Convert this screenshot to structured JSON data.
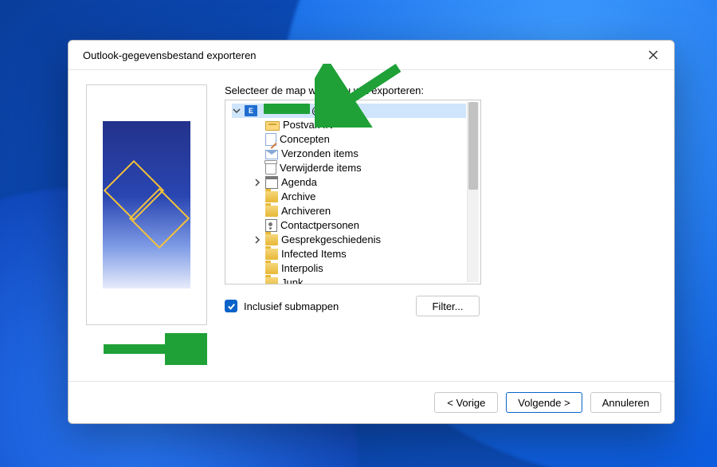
{
  "dialog": {
    "title": "Outlook-gegevensbestand exporteren",
    "field_label": "Selecteer de map waaruit u wilt exporteren:",
    "account_icon_letter": "E",
    "account_suffix": "@live.nl",
    "folders": [
      {
        "label": "Postvak IN",
        "icon": "inbox"
      },
      {
        "label": "Concepten",
        "icon": "draft"
      },
      {
        "label": "Verzonden items",
        "icon": "sent"
      },
      {
        "label": "Verwijderde items",
        "icon": "trash"
      },
      {
        "label": "Agenda",
        "icon": "cal",
        "expandable": true
      },
      {
        "label": "Archive",
        "icon": "folder"
      },
      {
        "label": "Archiveren",
        "icon": "folder"
      },
      {
        "label": "Contactpersonen",
        "icon": "contacts"
      },
      {
        "label": "Gesprekgeschiedenis",
        "icon": "folder",
        "expandable": true
      },
      {
        "label": "Infected Items",
        "icon": "folder"
      },
      {
        "label": "Interpolis",
        "icon": "folder"
      },
      {
        "label": "Junk",
        "icon": "folder"
      }
    ],
    "checkbox_label": "Inclusief submappen",
    "filter_button": "Filter...",
    "back_button": "< Vorige",
    "next_button": "Volgende >",
    "cancel_button": "Annuleren"
  }
}
